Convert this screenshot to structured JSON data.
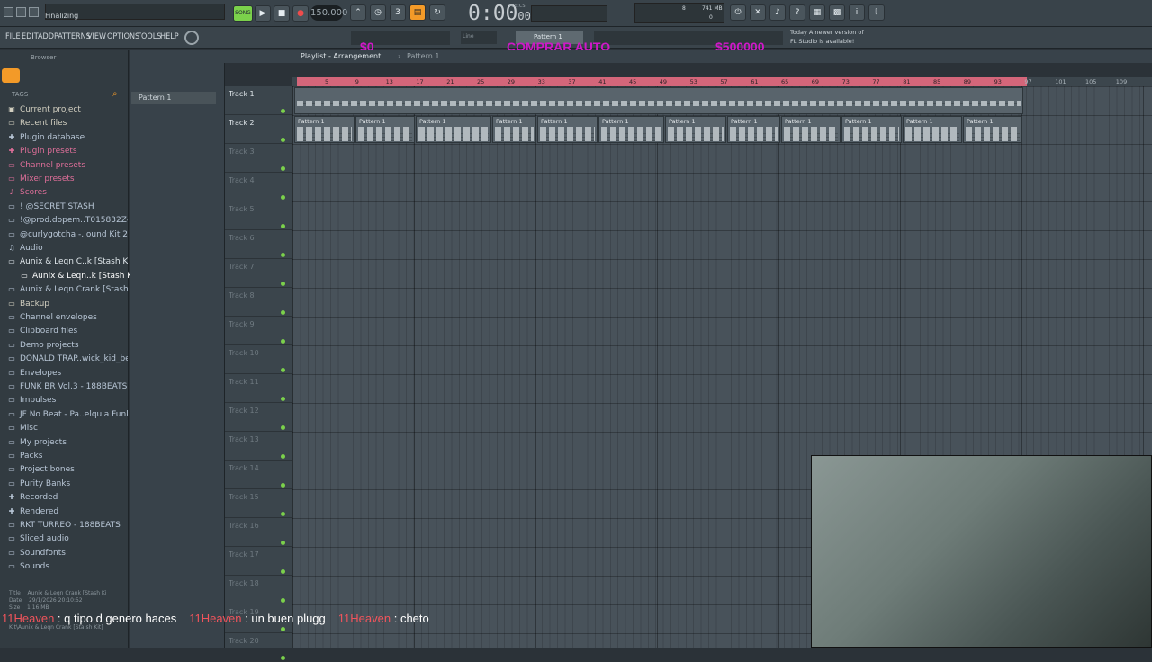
{
  "titlebar": {
    "title": "Finalizing"
  },
  "menu": [
    "FILE",
    "EDIT",
    "ADD",
    "PATTERNS",
    "VIEW",
    "OPTIONS",
    "TOOLS",
    "HELP"
  ],
  "transport": {
    "tempo": "150.000",
    "time": "0:00",
    "time_sub": "00",
    "time_unit": "M:S:CS",
    "song_mode_label": "SONG",
    "pattern_label": "Pattern 1",
    "snap_label": "Line",
    "cpu": "8",
    "memory": "741 MB",
    "voices": "0"
  },
  "news": {
    "line1": "Today  A newer version of",
    "line2": "FL Studio is available!"
  },
  "overlays": {
    "left_amount": "$0",
    "center_label": "COMPRAR AUTO",
    "right_amount": "$500000"
  },
  "browser": {
    "title": "Browser",
    "tags_label": "TAGS",
    "items": [
      {
        "label": "Current project",
        "icon": "project-icon",
        "color": "#d2cfc0"
      },
      {
        "label": "Recent files",
        "icon": "folder-icon",
        "color": "#d2cfc0"
      },
      {
        "label": "Plugin database",
        "icon": "plug-icon",
        "color": "#b8c6d6"
      },
      {
        "label": "Plugin presets",
        "icon": "plug-icon",
        "color": "#e06f9a"
      },
      {
        "label": "Channel presets",
        "icon": "channel-icon",
        "color": "#e06f9a"
      },
      {
        "label": "Mixer presets",
        "icon": "mixer-icon",
        "color": "#e06f9a"
      },
      {
        "label": "Scores",
        "icon": "score-icon",
        "color": "#e06f9a"
      },
      {
        "label": "! @SECRET STASH",
        "icon": "folder-icon",
        "color": "#b8c6d6"
      },
      {
        "label": "!@prod.dopem..T015832Z-001",
        "icon": "folder-icon",
        "color": "#b8c6d6"
      },
      {
        "label": "@curlygotcha -..ound Kit 2024",
        "icon": "folder-icon",
        "color": "#b8c6d6"
      },
      {
        "label": "Audio",
        "icon": "audio-icon",
        "color": "#b8c6d6"
      },
      {
        "label": "Aunix & Leqn C..k [Stash Kit]",
        "icon": "folder-icon",
        "color": "#dfe6ea"
      },
      {
        "label": "Aunix & Leqn..k [Stash Kit]",
        "icon": "folder-icon",
        "color": "#ffffff"
      },
      {
        "label": "Aunix & Leqn Crank [Stash Kit]",
        "icon": "folder-icon",
        "color": "#b8c6d6"
      },
      {
        "label": "Backup",
        "icon": "folder-icon",
        "color": "#d2cfc0"
      },
      {
        "label": "Channel envelopes",
        "icon": "folder-icon",
        "color": "#b8c6d6"
      },
      {
        "label": "Clipboard files",
        "icon": "folder-icon",
        "color": "#b8c6d6"
      },
      {
        "label": "Demo projects",
        "icon": "folder-icon",
        "color": "#b8c6d6"
      },
      {
        "label": "DONALD TRAP..wick_kid_beats",
        "icon": "folder-icon",
        "color": "#b8c6d6"
      },
      {
        "label": "Envelopes",
        "icon": "folder-icon",
        "color": "#b8c6d6"
      },
      {
        "label": "FUNK BR Vol.3 - 188BEATS",
        "icon": "folder-icon",
        "color": "#b8c6d6"
      },
      {
        "label": "Impulses",
        "icon": "folder-icon",
        "color": "#b8c6d6"
      },
      {
        "label": "JF No Beat - Pa..elquia Funk 2",
        "icon": "folder-icon",
        "color": "#b8c6d6"
      },
      {
        "label": "Misc",
        "icon": "folder-icon",
        "color": "#b8c6d6"
      },
      {
        "label": "My projects",
        "icon": "folder-icon",
        "color": "#b8c6d6"
      },
      {
        "label": "Packs",
        "icon": "folder-icon",
        "color": "#b8c6d6"
      },
      {
        "label": "Project bones",
        "icon": "folder-icon",
        "color": "#b8c6d6"
      },
      {
        "label": "Purity Banks",
        "icon": "folder-icon",
        "color": "#b8c6d6"
      },
      {
        "label": "Recorded",
        "icon": "plus-icon",
        "color": "#b8c6d6"
      },
      {
        "label": "Rendered",
        "icon": "plus-icon",
        "color": "#b8c6d6"
      },
      {
        "label": "RKT TURREO - 188BEATS",
        "icon": "folder-icon",
        "color": "#b8c6d6"
      },
      {
        "label": "Sliced audio",
        "icon": "folder-icon",
        "color": "#b8c6d6"
      },
      {
        "label": "Soundfonts",
        "icon": "folder-icon",
        "color": "#b8c6d6"
      },
      {
        "label": "Sounds",
        "icon": "folder-icon",
        "color": "#b8c6d6"
      }
    ],
    "info": {
      "title_label": "Title",
      "title_value": "Aunix & Leqn Crank [Stash Ki",
      "date_label": "Date",
      "date_value": "29/1/2026 20:10:52",
      "size_label": "Size",
      "size_value": "1.16 MB",
      "path": "Kit\\Aunix & Leqn Crank [Sta sh Kit]"
    }
  },
  "pattern_panel": {
    "selected": "Pattern 1"
  },
  "playlist": {
    "title": "Playlist - Arrangement",
    "breadcrumb_sep": "›",
    "pattern": "Pattern 1",
    "ruler": [
      "5",
      "9",
      "13",
      "17",
      "21",
      "25",
      "29",
      "33",
      "37",
      "41",
      "45",
      "49",
      "53",
      "57",
      "61",
      "65",
      "69",
      "73",
      "77",
      "81",
      "85",
      "89",
      "93",
      "97",
      "101",
      "105",
      "109"
    ],
    "tracks": [
      "Track 1",
      "Track 2",
      "Track 3",
      "Track 4",
      "Track 5",
      "Track 6",
      "Track 7",
      "Track 8",
      "Track 9",
      "Track 10",
      "Track 11",
      "Track 12",
      "Track 13",
      "Track 14",
      "Track 15",
      "Track 16",
      "Track 17",
      "Track 18",
      "Track 19",
      "Track 20"
    ],
    "clip_label": "Pattern 1"
  },
  "chat": [
    {
      "user": "11Heaven",
      "message": "q tipo d genero haces"
    },
    {
      "user": "11Heaven",
      "message": "un buen plugg"
    },
    {
      "user": "11Heaven",
      "message": "cheto"
    }
  ],
  "colors": {
    "accent": "#f39a28",
    "ruler": "#d4667a",
    "led": "#7bd14b",
    "chat_user": "#f1545c",
    "overlay": "#d018c8"
  }
}
